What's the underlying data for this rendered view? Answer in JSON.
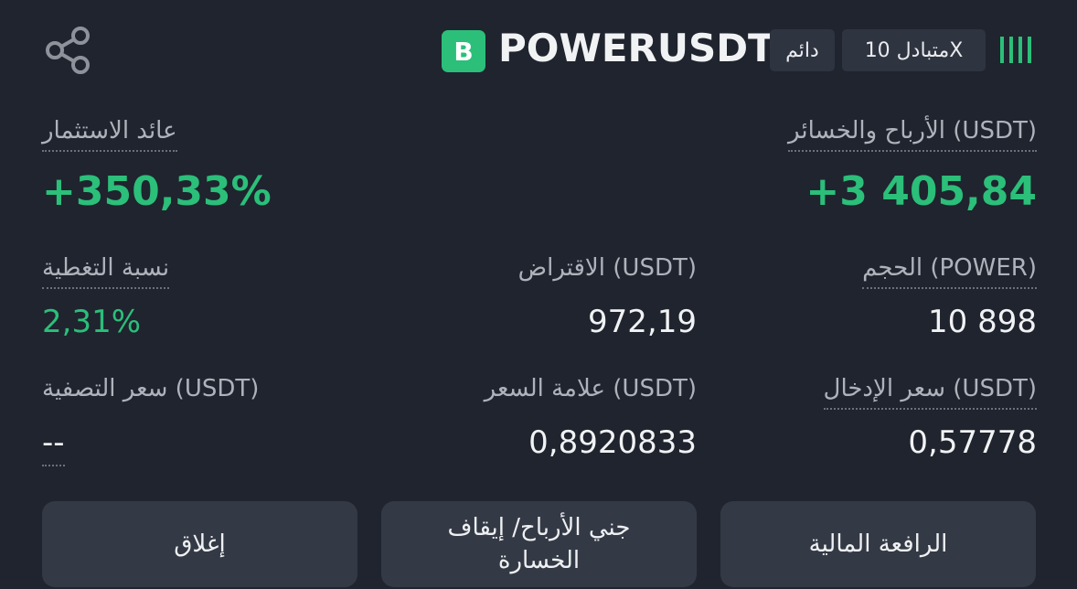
{
  "header": {
    "share_icon": "share-icon",
    "badge": "B",
    "symbol": "POWERUSDT",
    "perpetual_tag": "دائم",
    "leverage_tag": "متبادل 10X",
    "signal_icon": "signal-bars-icon",
    "accent_color": "#2bbf7a"
  },
  "pnl": {
    "label": "الأرباح والخسائر (USDT)",
    "value": "+3 405,84"
  },
  "roi": {
    "label": "عائد الاستثمار",
    "value": "+350,33%"
  },
  "size": {
    "label": "الحجم (POWER)",
    "value": "10 898"
  },
  "margin": {
    "label": "الاقتراض (USDT)",
    "value": "972,19"
  },
  "margin_ratio": {
    "label": "نسبة التغطية",
    "value": "2,31%"
  },
  "entry_price": {
    "label": "سعر الإدخال (USDT)",
    "value": "0,57778"
  },
  "mark_price": {
    "label": "علامة السعر (USDT)",
    "value": "0,8920833"
  },
  "liq_price": {
    "label": "سعر التصفية (USDT)",
    "value": "--"
  },
  "buttons": {
    "leverage": "الرافعة المالية",
    "tpsl": "جني الأرباح/ إيقاف الخسارة",
    "close": "إغلاق"
  }
}
